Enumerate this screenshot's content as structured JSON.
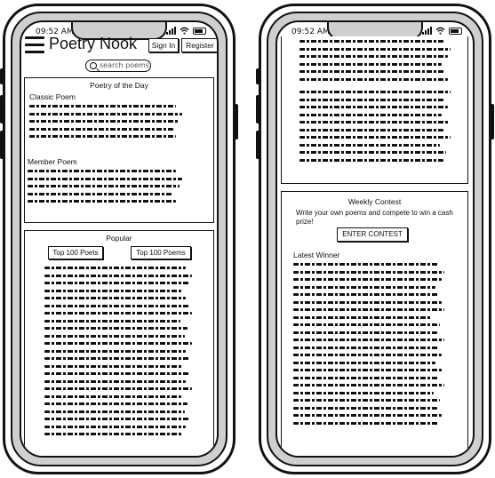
{
  "status": {
    "time": "09:52 AM"
  },
  "header": {
    "title": "Poetry Nook",
    "sign_in": "Sign In",
    "register": "Register"
  },
  "search": {
    "placeholder": "search poems"
  },
  "poem_of_day": {
    "title": "Poetry of the Day",
    "classic": "Classic Poem",
    "member": "Member Poem"
  },
  "popular": {
    "title": "Popular",
    "top_poets": "Top 100 Poets",
    "top_poems": "Top 100 Poems"
  },
  "contest": {
    "title": "Weekly Contest",
    "description": "Write your own poems and compete to win a cash prize!",
    "button": "ENTER CONTEST",
    "latest_winner": "Latest Winner"
  }
}
